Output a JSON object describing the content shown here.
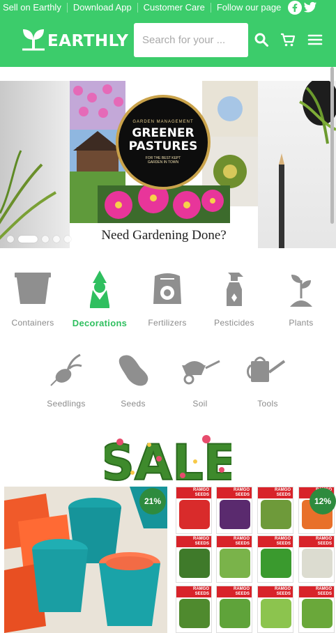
{
  "top_links": [
    "Sell on Earthly",
    "Download App",
    "Customer Care",
    "Follow our page"
  ],
  "brand": {
    "name": "EARTHLY",
    "color": "#3ccc6b"
  },
  "search": {
    "placeholder": "Search for your ..."
  },
  "header_icons": [
    "search-icon",
    "cart-icon",
    "menu-icon"
  ],
  "social_icons": [
    "facebook-icon",
    "twitter-icon"
  ],
  "carousel": {
    "badge_top": "GARDEN MANAGEMENT",
    "badge_line1": "GREENER",
    "badge_line2": "PASTURES",
    "badge_sub": "FOR THE BEST KEPT GARDEN IN TOWN",
    "caption": "Need Gardening Done?",
    "slide_count": 5,
    "active_slide": 2
  },
  "categories": [
    {
      "label": "Containers",
      "icon": "pot-icon",
      "active": false
    },
    {
      "label": "Decorations",
      "icon": "gnome-icon",
      "active": true
    },
    {
      "label": "Fertilizers",
      "icon": "fertilizer-bag-icon",
      "active": false
    },
    {
      "label": "Pesticides",
      "icon": "spray-bottle-icon",
      "active": false
    },
    {
      "label": "Plants",
      "icon": "sprout-icon",
      "active": false
    },
    {
      "label": "Seedlings",
      "icon": "radish-icon",
      "active": false
    },
    {
      "label": "Seeds",
      "icon": "bean-icon",
      "active": false
    },
    {
      "label": "Soil",
      "icon": "wheelbarrow-icon",
      "active": false
    },
    {
      "label": "Tools",
      "icon": "watering-can-icon",
      "active": false
    }
  ],
  "sale": {
    "title": "SALE"
  },
  "products": [
    {
      "discount": "21%"
    },
    {
      "discount": "12%"
    }
  ],
  "seed_packet_label": "RAMGO SEEDS",
  "colors": {
    "accent": "#3ccc6b",
    "badge": "#2e8b3e",
    "icon_gray": "#8f8f8f"
  }
}
